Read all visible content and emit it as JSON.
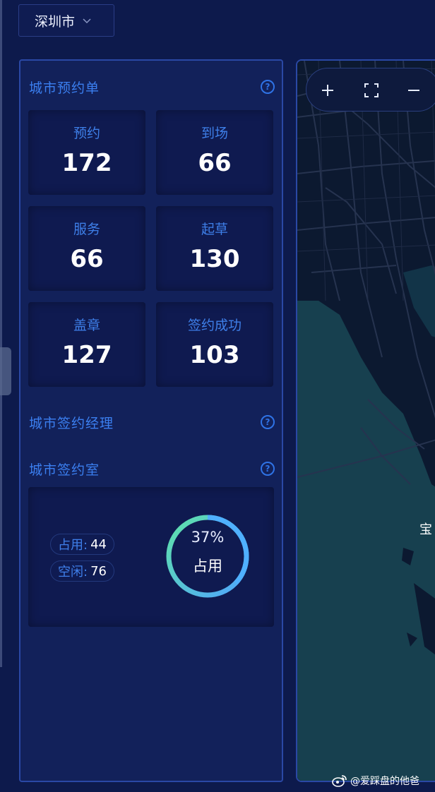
{
  "city_select": {
    "value": "深圳市",
    "icon": "chevron-down-icon"
  },
  "sections": {
    "appointments": {
      "title": "城市预约单",
      "icon": "question-circle-icon"
    },
    "managers": {
      "title": "城市签约经理",
      "icon": "question-circle-icon"
    },
    "rooms": {
      "title": "城市签约室",
      "icon": "question-circle-icon"
    }
  },
  "stats": [
    {
      "label": "预约",
      "value": "172"
    },
    {
      "label": "到场",
      "value": "66"
    },
    {
      "label": "服务",
      "value": "66"
    },
    {
      "label": "起草",
      "value": "130"
    },
    {
      "label": "盖章",
      "value": "127"
    },
    {
      "label": "签约成功",
      "value": "103"
    }
  ],
  "rooms": {
    "occupied_label": "占用:",
    "occupied_value": "44",
    "idle_label": "空闲:",
    "idle_value": "76",
    "donut_percent_text": "37%",
    "donut_caption": "占用",
    "occupied_fraction": 0.37
  },
  "map": {
    "controls": [
      "plus-icon",
      "fullscreen-icon",
      "minus-icon"
    ],
    "place_label": "宝"
  },
  "watermark": {
    "text": "@爱踩盘的他爸",
    "icon": "weibo-icon"
  },
  "colors": {
    "background": "#0d1a4c",
    "panel": "#12215a",
    "card": "#0f1a50",
    "accent_blue": "#3b7ff0",
    "donut_start": "#5fe3a8",
    "donut_end": "#4fa5ff",
    "map_water": "#17404f",
    "map_land": "#0c1930"
  }
}
